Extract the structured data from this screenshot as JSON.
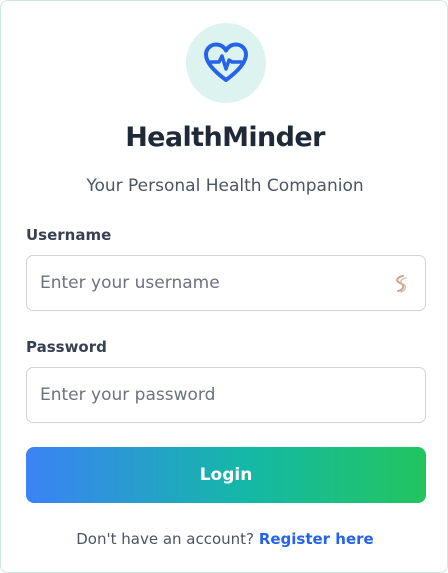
{
  "app": {
    "title": "HealthMinder",
    "tagline": "Your Personal Health Companion",
    "logo_icon": "heart-pulse-icon"
  },
  "form": {
    "username_label": "Username",
    "username_placeholder": "Enter your username",
    "username_value": "",
    "username_icon": "key-icon",
    "password_label": "Password",
    "password_placeholder": "Enter your password",
    "password_value": "",
    "login_label": "Login"
  },
  "footer": {
    "prompt": "Don't have an account?",
    "register_label": "Register here"
  },
  "colors": {
    "accent_blue": "#2563eb",
    "gradient_start": "#3b82f6",
    "gradient_end": "#22c55e",
    "logo_background": "#ddf3f0",
    "title_text": "#1f2937"
  }
}
